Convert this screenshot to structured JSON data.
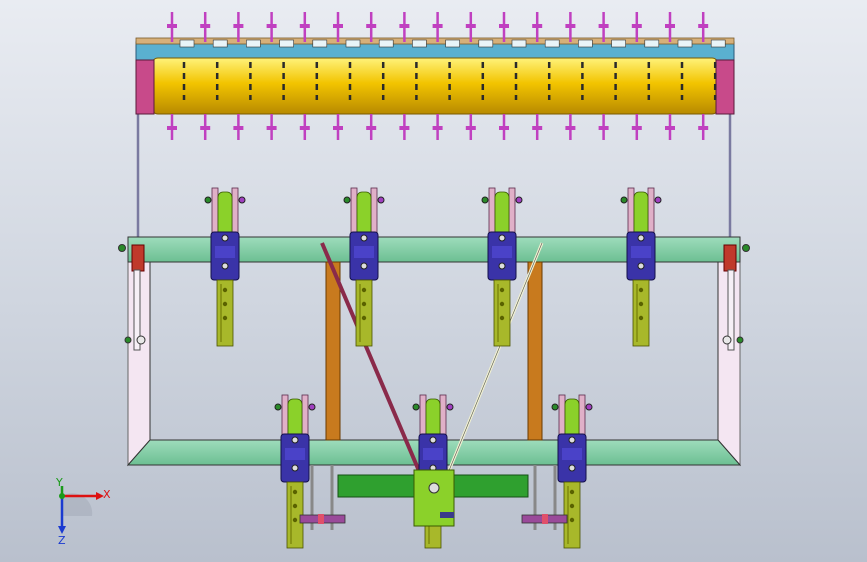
{
  "viewport": {
    "background_top": "#e9ecf2",
    "background_bottom": "#b9c0cd"
  },
  "model": {
    "roller_color": "#f2c400",
    "tine_color": "#c040c0",
    "frame_color": "#7cc9a0",
    "clamp_color": "#3a33a8",
    "bracket_color": "#8bd12a",
    "shank_color": "#a8b82a",
    "post_color": "#c87a1e",
    "shaft_color": "#2fa02f",
    "brace_left_color": "#8a2a4a",
    "brace_right_color": "#f0f0d0",
    "top_bar_color": "#5ab0d0",
    "side_panel_color": "#f4e6f2",
    "upper_unit_count": 4,
    "lower_unit_count": 3
  },
  "triad": {
    "x_label": "X",
    "y_label": "Y",
    "z_label": "Z",
    "x_color": "#d11",
    "y_color": "#1a9a1a",
    "z_color": "#1a3ad0"
  }
}
